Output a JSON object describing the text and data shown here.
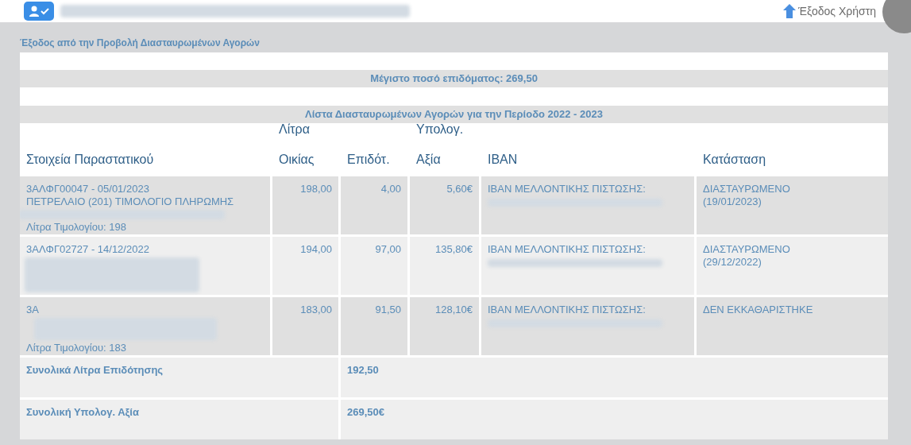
{
  "top_bar": {
    "logout": "Έξοδος Χρήστη"
  },
  "exit_link": "Έξοδος από την Προβολή Διασταυρωμένων Αγορών",
  "max_amount": "Μέγιστο ποσό επιδόματος: 269,50",
  "list_title": "Λίστα Διασταυρωμένων Αγορών για την Περίοδο 2022 - 2023",
  "table": {
    "columns": [
      {
        "label": "Στοιχεία Παραστατικού"
      },
      {
        "top": "Λίτρα",
        "label": "Οικίας"
      },
      {
        "label": "Επιδότ."
      },
      {
        "top": "Υπολογ.",
        "label": "Αξία"
      },
      {
        "label": "IBAN"
      },
      {
        "label": "Κατάσταση"
      }
    ],
    "rows": [
      {
        "document": [
          {
            "kind": "text",
            "text": "3ΑΛΦΓ00047 - 05/01/2023"
          },
          {
            "kind": "text",
            "text": "ΠΕΤΡΕΛΑΙΟ (201) ΤΙΜΟΛΟΓΙΟ ΠΛΗΡΩΜΗΣ"
          },
          {
            "kind": "redacted-line"
          },
          {
            "kind": "text",
            "text": "Λίτρα Τιμολογίου: 198"
          }
        ],
        "home": "198,00",
        "subsidy": "4,00",
        "value": "5,60€",
        "iban": "ΙΒΑΝ ΜΕΛΛΟΝΤΙΚΗΣ ΠΙΣΤΩΣΗΣ:",
        "status": [
          "ΔΙΑΣΤΑΥΡΩΜΕΝΟ",
          "(19/01/2023)"
        ]
      },
      {
        "document": [
          {
            "kind": "text",
            "text": "3ΑΛΦΓ02727 - 14/12/2022"
          },
          {
            "kind": "redacted-block"
          }
        ],
        "home": "194,00",
        "subsidy": "97,00",
        "value": "135,80€",
        "iban": "ΙΒΑΝ ΜΕΛΛΟΝΤΙΚΗΣ ΠΙΣΤΩΣΗΣ:",
        "status": [
          "ΔΙΑΣΤΑΥΡΩΜΕΝΟ",
          "(29/12/2022)"
        ]
      },
      {
        "document": [
          {
            "kind": "text",
            "text": "3Α"
          },
          {
            "kind": "redacted-lines"
          },
          {
            "kind": "text",
            "text": "Λίτρα Τιμολογίου: 183"
          }
        ],
        "home": "183,00",
        "subsidy": "91,50",
        "value": "128,10€",
        "iban": "ΙΒΑΝ ΜΕΛΛΟΝΤΙΚΗΣ ΠΙΣΤΩΣΗΣ:",
        "status": [
          "ΔΕΝ ΕΚΚΑΘΑΡΙΣΤΗΚΕ"
        ]
      }
    ],
    "totals": [
      {
        "label": "Συνολικά Λίτρα Επιδότησης",
        "value": "192,50"
      },
      {
        "label": "Συνολική Υπολογ. Αξία",
        "value": "269,50€"
      }
    ]
  }
}
